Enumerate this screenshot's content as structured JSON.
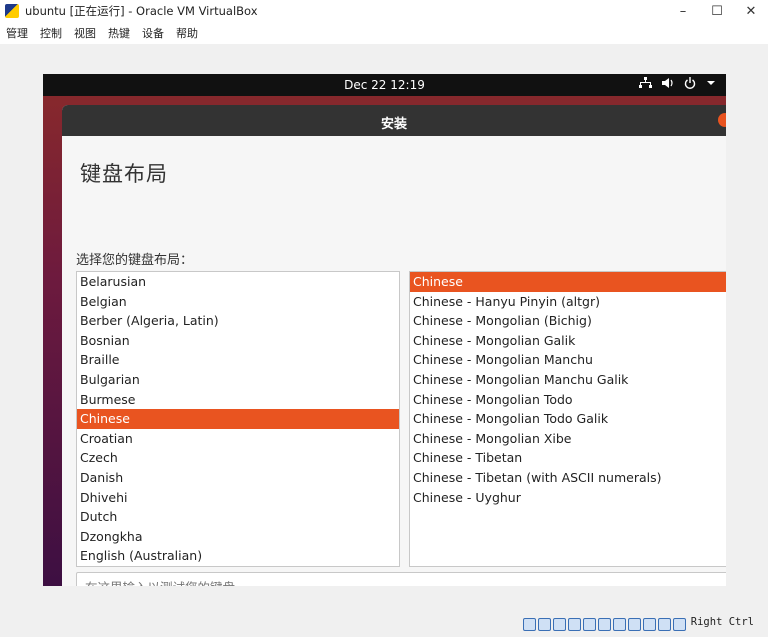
{
  "window": {
    "title": "ubuntu [正在运行] - Oracle VM VirtualBox",
    "minimize": "–",
    "maximize": "☐",
    "close": "✕"
  },
  "menu": [
    "管理",
    "控制",
    "视图",
    "热键",
    "设备",
    "帮助"
  ],
  "vm": {
    "clock": "Dec 22  12:19",
    "installer_title": "安装",
    "heading": "键盘布局",
    "prompt": "选择您的键盘布局：",
    "layouts": [
      "Belarusian",
      "Belgian",
      "Berber (Algeria, Latin)",
      "Bosnian",
      "Braille",
      "Bulgarian",
      "Burmese",
      "Chinese",
      "Croatian",
      "Czech",
      "Danish",
      "Dhivehi",
      "Dutch",
      "Dzongkha",
      "English (Australian)"
    ],
    "selected_layout": "Chinese",
    "variants": [
      "Chinese",
      "Chinese - Hanyu Pinyin (altgr)",
      "Chinese - Mongolian (Bichig)",
      "Chinese - Mongolian Galik",
      "Chinese - Mongolian Manchu",
      "Chinese - Mongolian Manchu Galik",
      "Chinese - Mongolian Todo",
      "Chinese - Mongolian Todo Galik",
      "Chinese - Mongolian Xibe",
      "Chinese - Tibetan",
      "Chinese - Tibetan (with ASCII numerals)",
      "Chinese - Uyghur"
    ],
    "selected_variant": "Chinese",
    "test_placeholder": "在这里输入以测试您的键盘",
    "accent_color": "#e95420"
  },
  "status": {
    "hostkey": "Right Ctrl"
  }
}
